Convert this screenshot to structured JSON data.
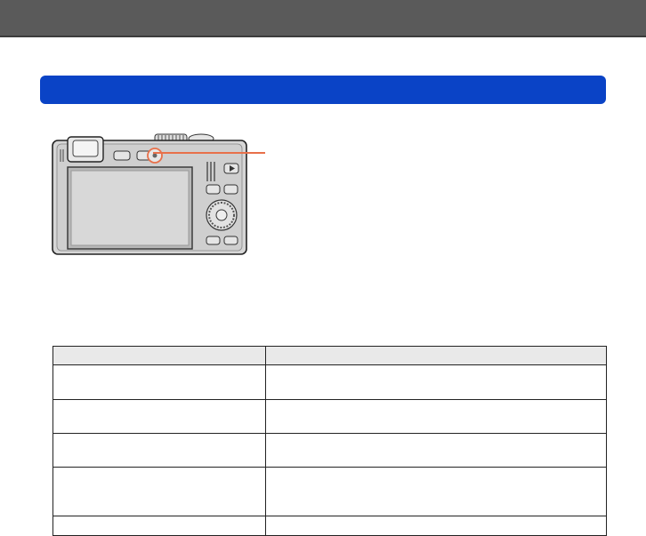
{
  "colors": {
    "top_band": "#5a5a5a",
    "section_bar": "#0a43c6",
    "indicator": "#e8704a",
    "table_header": "#e9e9e9"
  },
  "camera_image": {
    "icon": "camera-back-icon"
  },
  "table": {
    "header": [
      "",
      ""
    ],
    "rows": [
      [
        "",
        ""
      ],
      [
        "",
        ""
      ],
      [
        "",
        ""
      ],
      [
        "",
        ""
      ],
      [
        "",
        ""
      ]
    ]
  }
}
